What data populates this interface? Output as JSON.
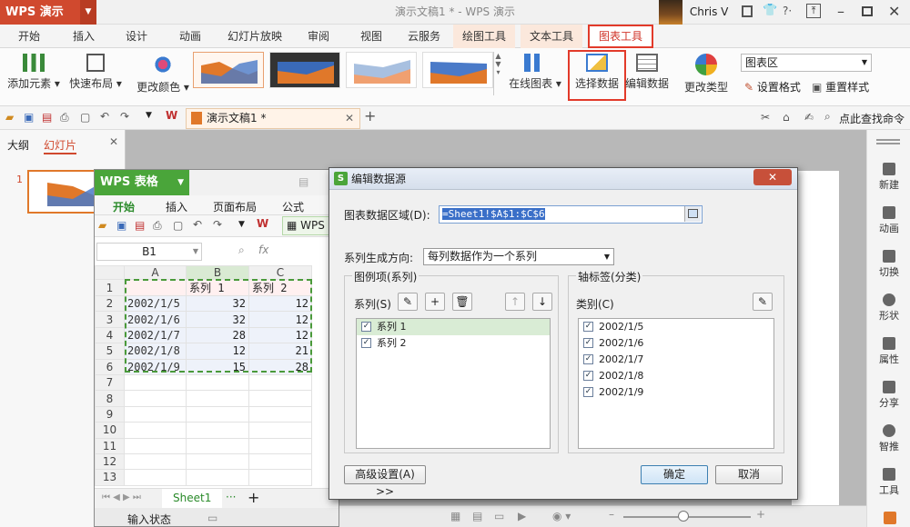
{
  "titlebar": {
    "app_name": "WPS 演示",
    "window_title": "演示文稿1 * - WPS 演示",
    "user_name": "Chris V"
  },
  "ribbon_tabs": [
    "开始",
    "插入",
    "设计",
    "动画",
    "幻灯片放映",
    "审阅",
    "视图",
    "云服务",
    "绘图工具",
    "文本工具",
    "图表工具"
  ],
  "ribbon": {
    "add_element": "添加元素",
    "quick_layout": "快速布局",
    "change_color": "更改颜色",
    "online_chart": "在线图表",
    "select_data": "选择数据",
    "edit_data": "编辑数据",
    "change_type": "更改类型",
    "chart_area_select": "图表区",
    "set_format": "设置格式",
    "reset_style": "重置样式"
  },
  "quickbar": {
    "doc_tab": "演示文稿1 *",
    "search": "点此查找命令"
  },
  "leftpanel": {
    "tab_outline": "大纲",
    "tab_slides": "幻灯片",
    "slide_number": "1"
  },
  "rightbar": [
    "新建",
    "动画",
    "切换",
    "形状",
    "属性",
    "分享",
    "智推",
    "工具"
  ],
  "sheet": {
    "app_name": "WPS 表格",
    "tabs": [
      "开始",
      "插入",
      "页面布局",
      "公式"
    ],
    "doc_tab": "WPS",
    "namebox": "B1",
    "col_headers": [
      "A",
      "B",
      "C"
    ],
    "rows": [
      {
        "n": "1",
        "a": "",
        "b": "系列 1",
        "c": "系列 2"
      },
      {
        "n": "2",
        "a": "2002/1/5",
        "b": "32",
        "c": "12"
      },
      {
        "n": "3",
        "a": "2002/1/6",
        "b": "32",
        "c": "12"
      },
      {
        "n": "4",
        "a": "2002/1/7",
        "b": "28",
        "c": "12"
      },
      {
        "n": "5",
        "a": "2002/1/8",
        "b": "12",
        "c": "21"
      },
      {
        "n": "6",
        "a": "2002/1/9",
        "b": "15",
        "c": "28"
      },
      {
        "n": "7",
        "a": "",
        "b": "",
        "c": ""
      },
      {
        "n": "8",
        "a": "",
        "b": "",
        "c": ""
      },
      {
        "n": "9",
        "a": "",
        "b": "",
        "c": ""
      },
      {
        "n": "10",
        "a": "",
        "b": "",
        "c": ""
      },
      {
        "n": "11",
        "a": "",
        "b": "",
        "c": ""
      },
      {
        "n": "12",
        "a": "",
        "b": "",
        "c": ""
      },
      {
        "n": "13",
        "a": "",
        "b": "",
        "c": ""
      }
    ],
    "sheet_tab": "Sheet1",
    "status": "输入状态"
  },
  "dialog": {
    "title": "编辑数据源",
    "range_label": "图表数据区域(D):",
    "range_value": "=Sheet1!$A$1:$C$6",
    "direction_label": "系列生成方向:",
    "direction_value": "每列数据作为一个系列",
    "legend_group": "图例项(系列)",
    "series_label": "系列(S)",
    "series_items": [
      "系列 1",
      "系列 2"
    ],
    "axis_group": "轴标签(分类)",
    "category_label": "类别(C)",
    "category_items": [
      "2002/1/5",
      "2002/1/6",
      "2002/1/7",
      "2002/1/8",
      "2002/1/9"
    ],
    "advanced": "高级设置(A) >>",
    "ok": "确定",
    "cancel": "取消"
  },
  "colors": {
    "accent_red": "#e23a2a",
    "wps_orange": "#d0492e",
    "et_green": "#4aa53a"
  }
}
